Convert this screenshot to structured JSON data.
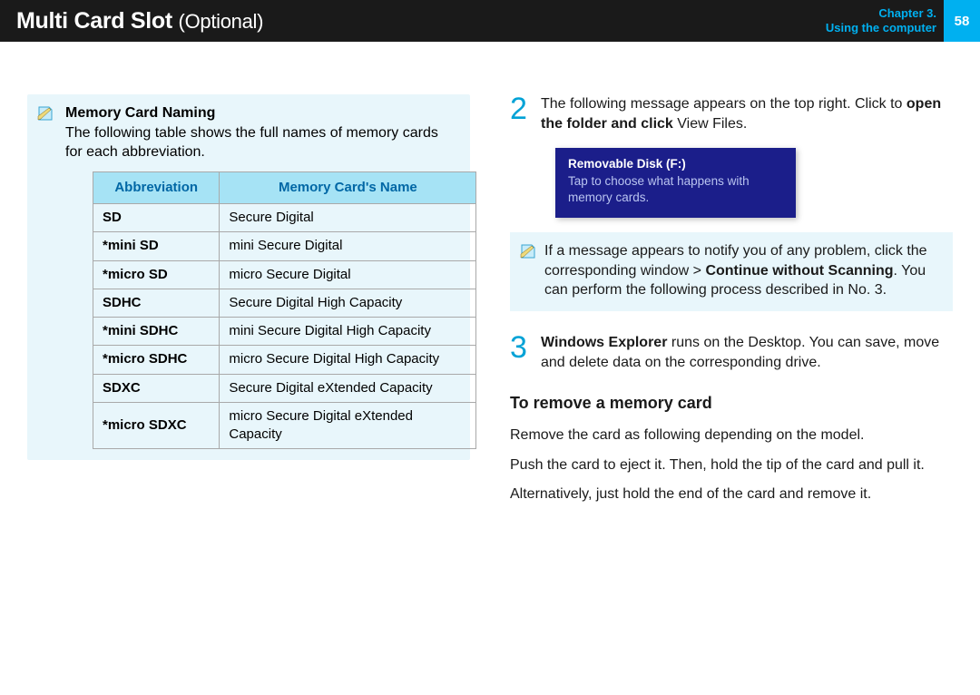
{
  "header": {
    "title_main": "Multi Card Slot",
    "title_suffix": "(Optional)",
    "chapter_line1": "Chapter 3.",
    "chapter_line2": "Using the computer",
    "page_number": "58"
  },
  "left": {
    "naming_head": "Memory Card Naming",
    "naming_intro": "The following table shows the full names of memory cards for each abbreviation.",
    "table": {
      "col_abbr": "Abbreviation",
      "col_name": "Memory Card's Name",
      "rows": [
        {
          "abbr": "SD",
          "name": "Secure Digital"
        },
        {
          "abbr": "*mini SD",
          "name": "mini Secure Digital"
        },
        {
          "abbr": "*micro SD",
          "name": "micro Secure Digital"
        },
        {
          "abbr": "SDHC",
          "name": "Secure Digital High Capacity"
        },
        {
          "abbr": "*mini SDHC",
          "name": "mini Secure Digital High Capacity"
        },
        {
          "abbr": "*micro SDHC",
          "name": "micro Secure Digital High Capacity"
        },
        {
          "abbr": "SDXC",
          "name": "Secure Digital eXtended Capacity"
        },
        {
          "abbr": "*micro SDXC",
          "name": "micro Secure Digital eXtended Capacity"
        }
      ]
    }
  },
  "right": {
    "step2_num": "2",
    "step2_a": "The following message appears on the top right. Click to ",
    "step2_b": "open the folder and click",
    "step2_c": " View Files.",
    "toast_title": "Removable Disk (F:)",
    "toast_text": "Tap to choose what happens with memory cards.",
    "tip_a": "If a message appears to notify you of any problem, click the corresponding window > ",
    "tip_b": "Continue without Scanning",
    "tip_c": ". You can perform the following process described in No. 3.",
    "step3_num": "3",
    "step3_a": "Windows Explorer",
    "step3_b": " runs on the Desktop. You can save, move and delete data on the corresponding drive.",
    "remove_head": "To remove a memory card",
    "remove_p1": "Remove the card as following depending on the model.",
    "remove_p2": "Push the card to eject it. Then, hold the tip of the card and pull it.",
    "remove_p3": "Alternatively, just hold the end of the card and remove it."
  },
  "colors": {
    "accent": "#00b0f0",
    "note_bg": "#e8f6fb",
    "toast_bg": "#1b1e8a"
  }
}
